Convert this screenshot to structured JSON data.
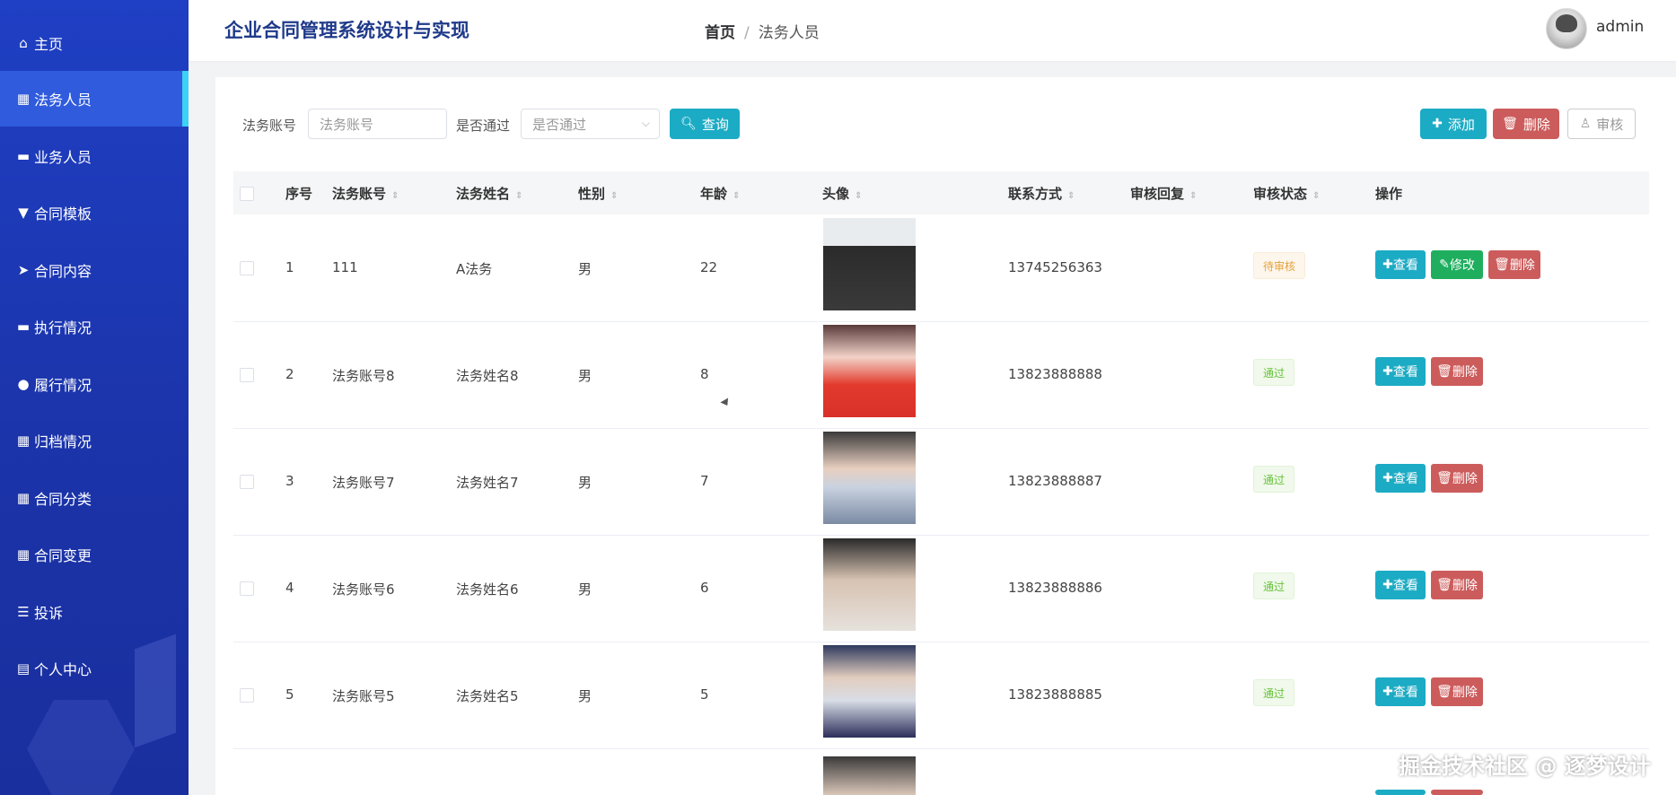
{
  "sidebar": {
    "items": [
      {
        "label": "主页",
        "icon": "home-icon",
        "glyph": "⌂"
      },
      {
        "label": "法务人员",
        "icon": "grid-icon",
        "glyph": "▦"
      },
      {
        "label": "业务人员",
        "icon": "briefcase-icon",
        "glyph": "▬"
      },
      {
        "label": "合同模板",
        "icon": "pin-icon",
        "glyph": "▼"
      },
      {
        "label": "合同内容",
        "icon": "send-icon",
        "glyph": "➤"
      },
      {
        "label": "执行情况",
        "icon": "ticket-icon",
        "glyph": "▬"
      },
      {
        "label": "履行情况",
        "icon": "user-icon",
        "glyph": "●"
      },
      {
        "label": "归档情况",
        "icon": "grid-icon",
        "glyph": "▦"
      },
      {
        "label": "合同分类",
        "icon": "grid-icon",
        "glyph": "▦"
      },
      {
        "label": "合同变更",
        "icon": "grid-icon",
        "glyph": "▦"
      },
      {
        "label": "投诉",
        "icon": "menu-lines-icon",
        "glyph": "☰"
      },
      {
        "label": "个人中心",
        "icon": "card-icon",
        "glyph": "▤"
      }
    ]
  },
  "header": {
    "title": "企业合同管理系统设计与实现",
    "breadcrumb": {
      "home": "首页",
      "sep": "/",
      "current": "法务人员"
    },
    "username": "admin"
  },
  "search": {
    "account_label": "法务账号",
    "account_placeholder": "法务账号",
    "pass_label": "是否通过",
    "pass_placeholder": "是否通过",
    "query_label": "查询"
  },
  "actions": {
    "add": "添加",
    "delete": "删除",
    "audit": "审核"
  },
  "table": {
    "headers": [
      "序号",
      "法务账号",
      "法务姓名",
      "性别",
      "年龄",
      "头像",
      "联系方式",
      "审核回复",
      "审核状态",
      "操作"
    ],
    "rows": [
      {
        "no": "1",
        "account": "111",
        "name": "A法务",
        "gender": "男",
        "age": "22",
        "phone": "13745256363",
        "reply": "",
        "status": "待审核",
        "status_type": "pending",
        "has_edit": true
      },
      {
        "no": "2",
        "account": "法务账号8",
        "name": "法务姓名8",
        "gender": "男",
        "age": "8",
        "phone": "13823888888",
        "reply": "",
        "status": "通过",
        "status_type": "pass",
        "has_edit": false
      },
      {
        "no": "3",
        "account": "法务账号7",
        "name": "法务姓名7",
        "gender": "男",
        "age": "7",
        "phone": "13823888887",
        "reply": "",
        "status": "通过",
        "status_type": "pass",
        "has_edit": false
      },
      {
        "no": "4",
        "account": "法务账号6",
        "name": "法务姓名6",
        "gender": "男",
        "age": "6",
        "phone": "13823888886",
        "reply": "",
        "status": "通过",
        "status_type": "pass",
        "has_edit": false
      },
      {
        "no": "5",
        "account": "法务账号5",
        "name": "法务姓名5",
        "gender": "男",
        "age": "5",
        "phone": "13823888885",
        "reply": "",
        "status": "通过",
        "status_type": "pass",
        "has_edit": false
      }
    ],
    "row_actions": {
      "view": "查看",
      "edit": "修改",
      "delete": "删除"
    }
  },
  "watermark": "掘金技术社区 @ 逐梦设计",
  "colors": {
    "sidebar": "#1f3fc4",
    "active": "#2f5bdc",
    "accent": "#1cabc4",
    "danger": "#cc5c5c",
    "success": "#1fae5e"
  }
}
